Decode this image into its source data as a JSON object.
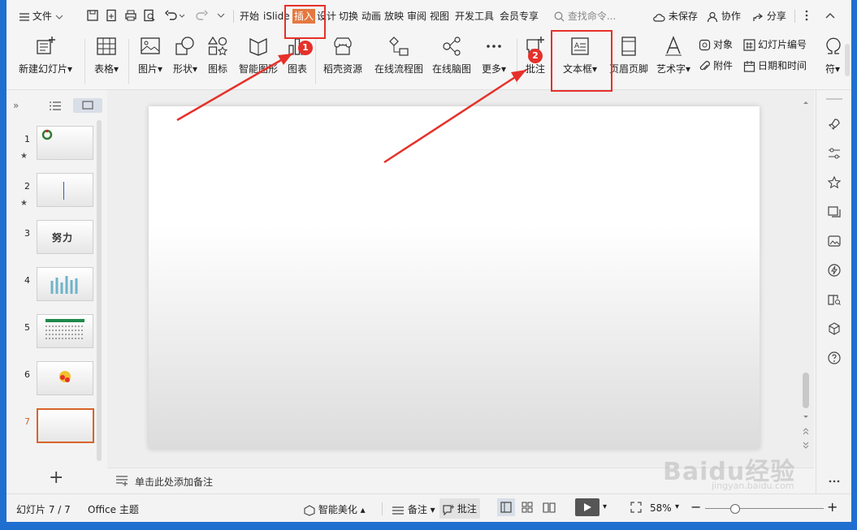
{
  "menu": {
    "file": "文件",
    "tabs": [
      "开始",
      "iSlide",
      "插入",
      "设计",
      "切换",
      "动画",
      "放映",
      "审阅",
      "视图",
      "开发工具",
      "会员专享"
    ],
    "active_tab": "插入",
    "search_placeholder": "查找命令...",
    "unsaved": "未保存",
    "collab": "协作",
    "share": "分享"
  },
  "ribbon": {
    "new_slide": "新建幻灯片",
    "table": "表格",
    "picture": "图片",
    "shape": "形状",
    "icon": "图标",
    "smart_graphic": "智能图形",
    "chart": "图表",
    "docer_resources": "稻壳资源",
    "online_flowchart": "在线流程图",
    "online_mindmap": "在线脑图",
    "more": "更多",
    "comment": "批注",
    "textbox": "文本框",
    "header_footer": "页眉页脚",
    "wordart": "艺术字",
    "object": "对象",
    "slide_number": "幻灯片编号",
    "attachment": "附件",
    "date_time": "日期和时间",
    "symbol": "符"
  },
  "slides": {
    "numbers": [
      "1",
      "2",
      "3",
      "4",
      "5",
      "6",
      "7"
    ],
    "thumb3_text": "努力",
    "current": "7"
  },
  "notes": {
    "placeholder": "单击此处添加备注"
  },
  "status": {
    "slide_info": "幻灯片 7 / 7",
    "theme": "Office 主题",
    "beautify": "智能美化",
    "notes": "备注",
    "comments": "批注",
    "zoom": "58%"
  },
  "annotations": {
    "badge1": "1",
    "badge2": "2",
    "color": "#e5312a"
  },
  "watermark": {
    "text": "Baidu经验",
    "url": "jingyan.baidu.com"
  }
}
